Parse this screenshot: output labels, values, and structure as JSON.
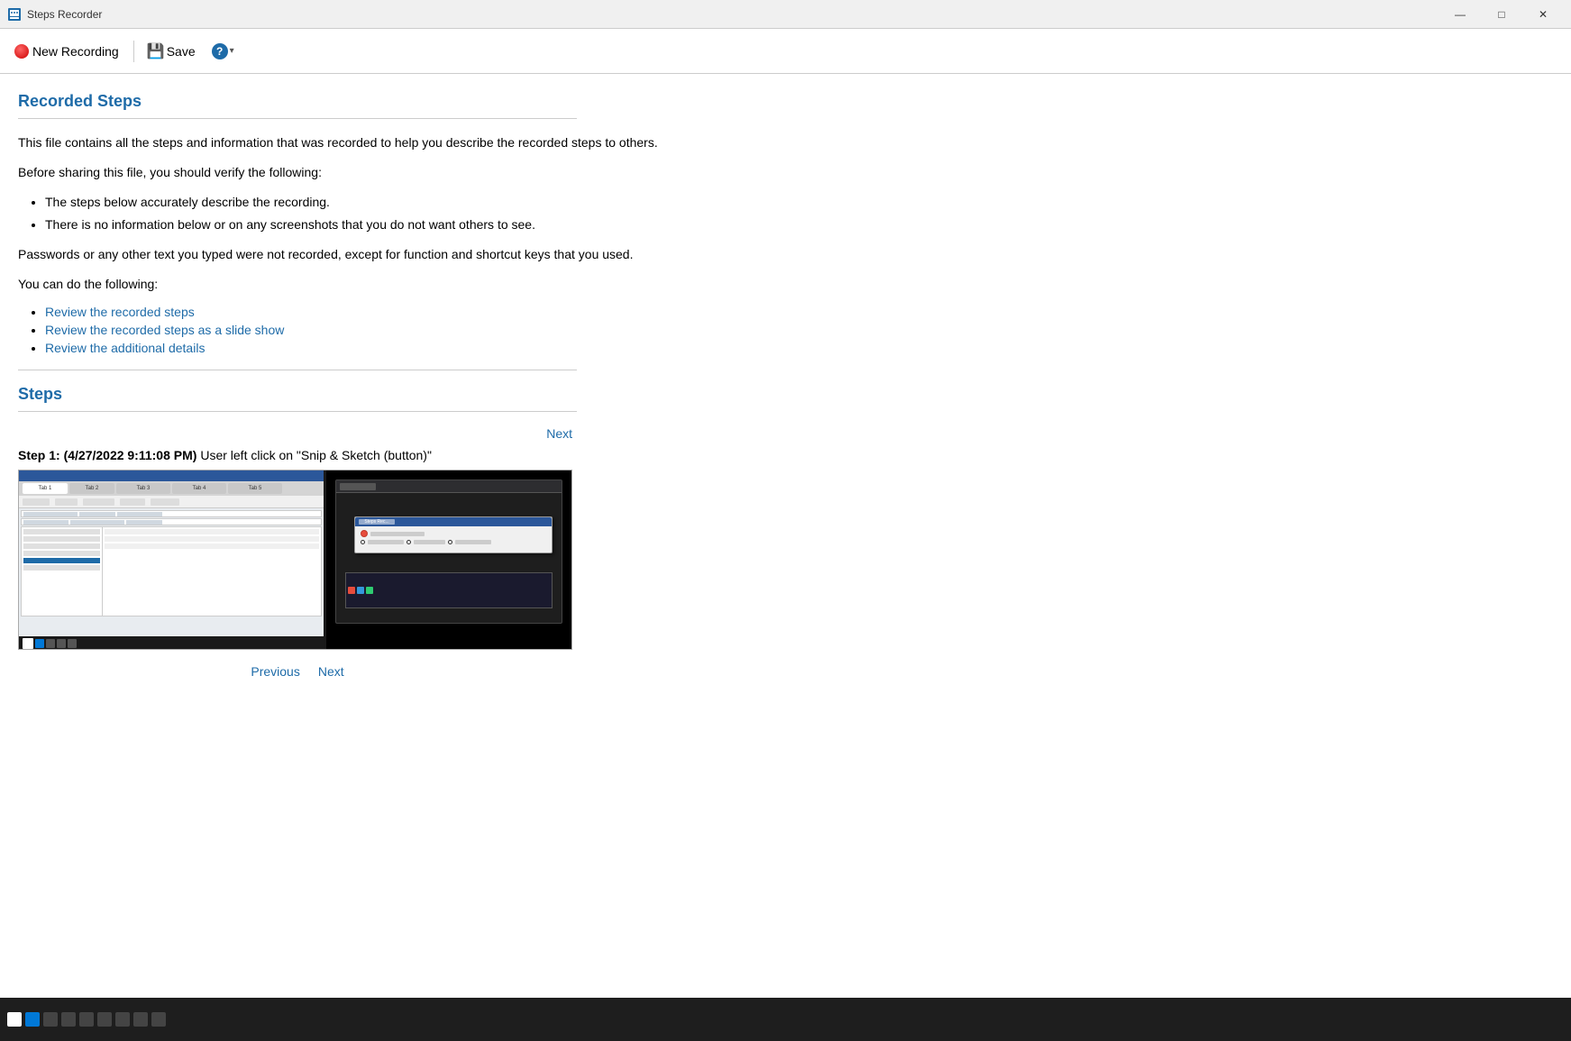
{
  "titleBar": {
    "icon": "🎬",
    "title": "Steps Recorder",
    "minimizeLabel": "—",
    "maximizeLabel": "□",
    "closeLabel": "✕"
  },
  "toolbar": {
    "newRecordingLabel": "New Recording",
    "saveLabel": "Save",
    "helpArrow": "▾"
  },
  "recordedSteps": {
    "sectionTitle": "Recorded Steps",
    "intro1": "This file contains all the steps and information that was recorded to help you describe the recorded steps to others.",
    "intro2": "Before sharing this file, you should verify the following:",
    "bullet1": "The steps below accurately describe the recording.",
    "bullet2": "There is no information below or on any screenshots that you do not want others to see.",
    "intro3": "Passwords or any other text you typed were not recorded, except for function and shortcut keys that you used.",
    "intro4": "You can do the following:",
    "link1": "Review the recorded steps",
    "link2": "Review the recorded steps as a slide show",
    "link3": "Review the additional details"
  },
  "steps": {
    "sectionTitle": "Steps",
    "nextLabel": "Next",
    "step1": {
      "heading": "Step 1: (4/27/2022 9:11:08 PM)",
      "description": "User left click on \"Snip & Sketch (button)\""
    },
    "previousLabel": "Previous",
    "nextLabel2": "Next"
  }
}
